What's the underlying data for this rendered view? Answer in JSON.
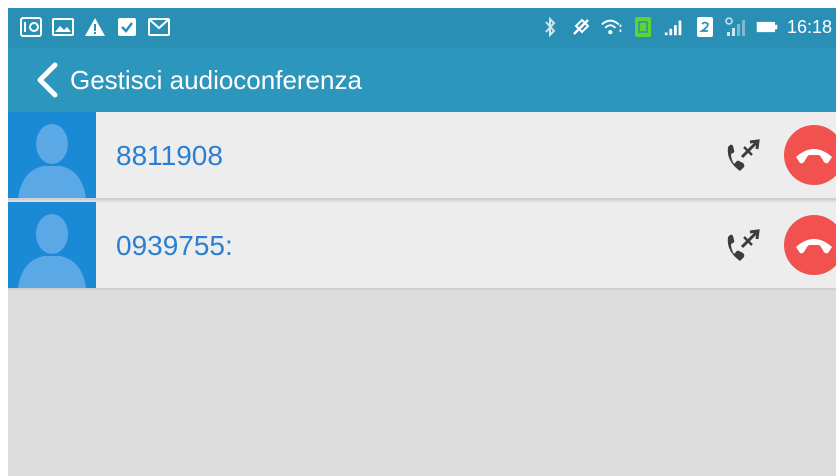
{
  "status_bar": {
    "time": "16:18",
    "left_icons": [
      "call-recording-icon",
      "image-icon",
      "warning-icon",
      "checkbox-icon",
      "gmail-icon"
    ],
    "right_icons": [
      "bluetooth-icon",
      "vibrate-off-icon",
      "wifi-icon",
      "sim1-icon",
      "signal-icon",
      "sim2-icon",
      "signal-weak-icon",
      "battery-icon"
    ]
  },
  "header": {
    "title": "Gestisci audioconferenza",
    "back_icon": "chevron-left-icon"
  },
  "participants": [
    {
      "number": "8811908"
    },
    {
      "number": "0939755:"
    }
  ],
  "colors": {
    "status_bar_bg": "#2a8fb5",
    "action_bar_bg": "#2d96bd",
    "avatar_bg": "#1a8ad6",
    "number_text": "#2b7fd3",
    "hangup_bg": "#f2524f",
    "background": "#dcdcdc"
  }
}
